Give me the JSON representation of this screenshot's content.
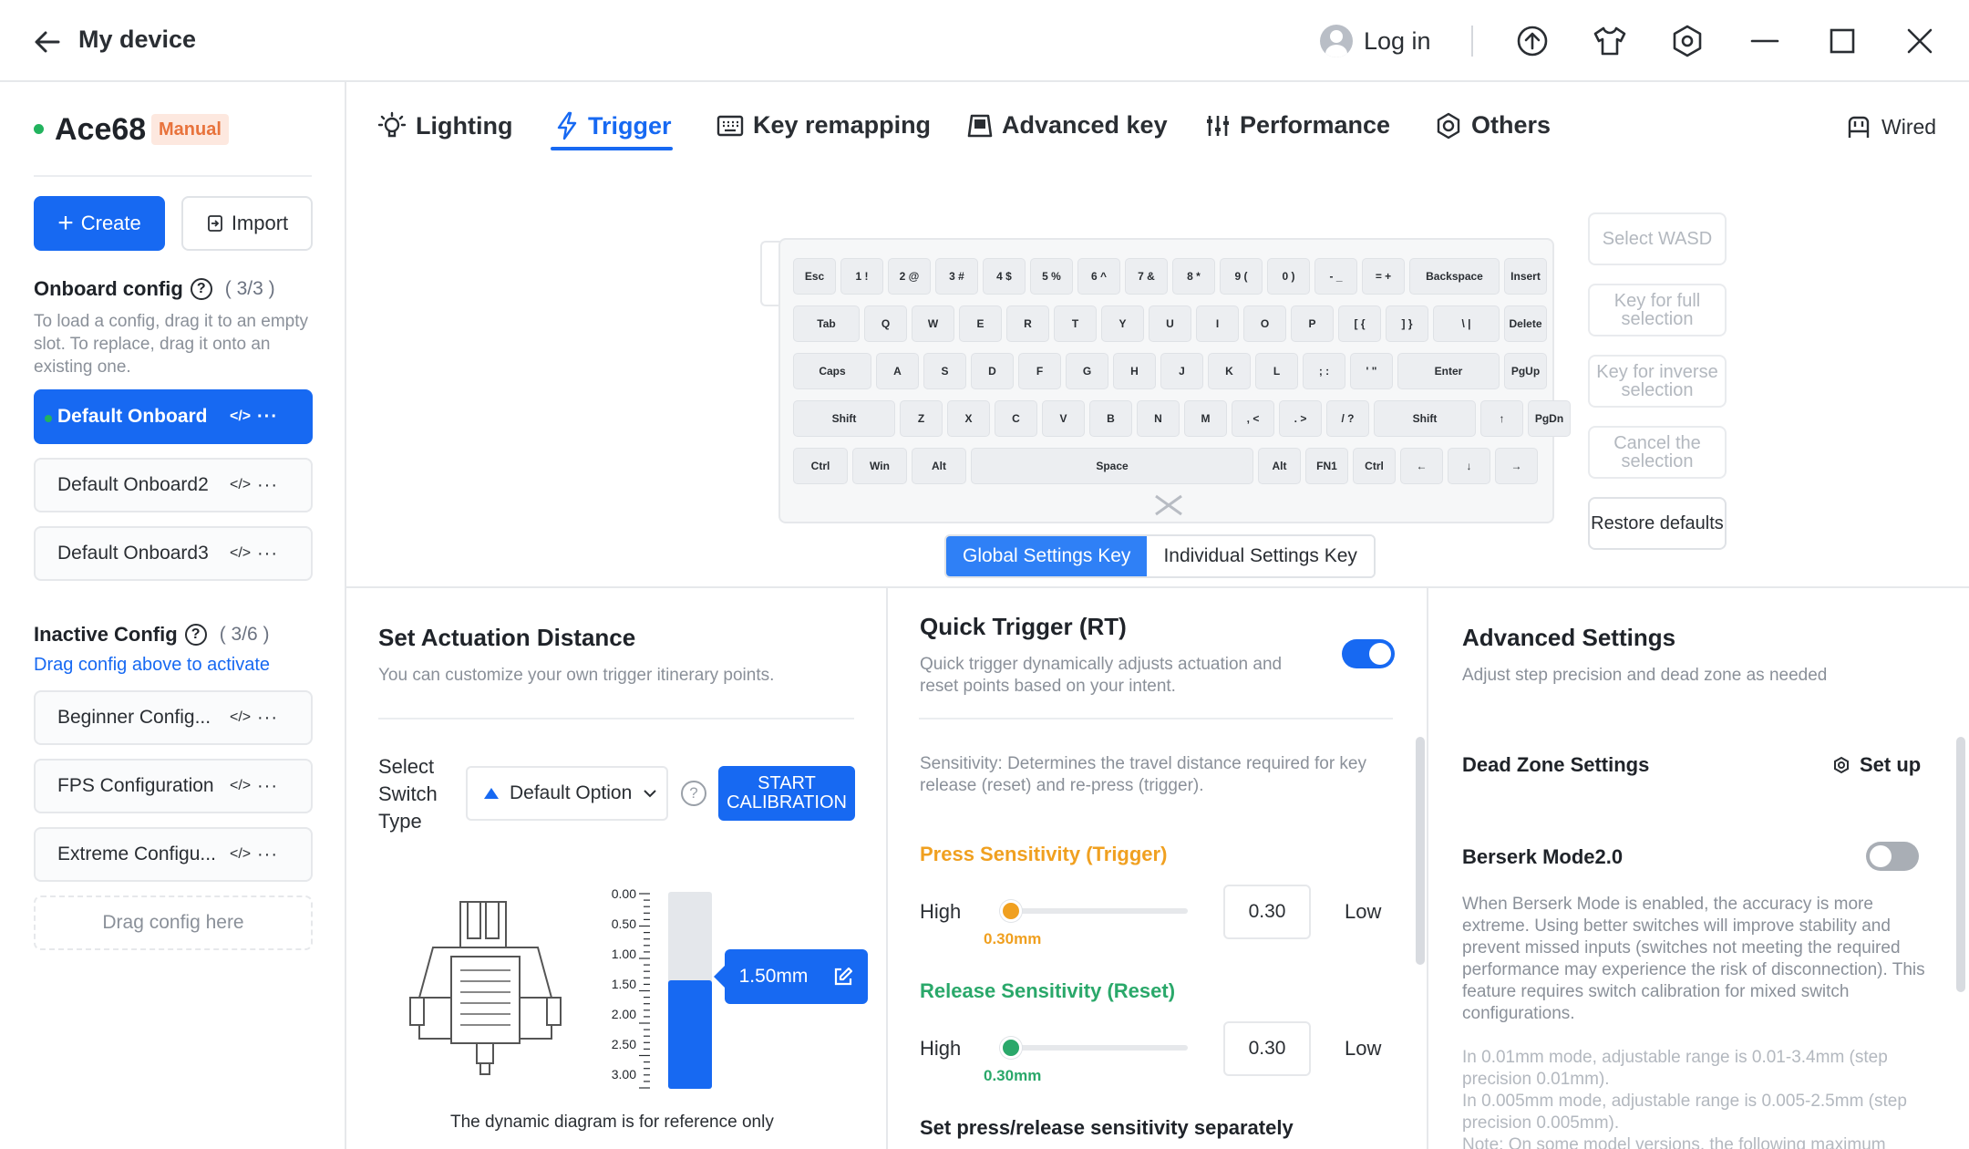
{
  "titlebar": {
    "title": "My device",
    "login": "Log in"
  },
  "device": {
    "name": "Ace68",
    "badge": "Manual"
  },
  "sidebar": {
    "create": "Create",
    "import": "Import",
    "onboard_title": "Onboard config",
    "onboard_count": "( 3/3 )",
    "onboard_desc": "To load a config, drag it to an empty slot. To replace, drag it onto an existing one.",
    "onboard_items": [
      "Default Onboard",
      "Default Onboard2",
      "Default Onboard3"
    ],
    "inactive_title": "Inactive Config",
    "inactive_count": "( 3/6 )",
    "drag_link": "Drag config above to activate",
    "inactive_items": [
      "Beginner Config...",
      "FPS Configuration",
      "Extreme Configu..."
    ],
    "drag_here": "Drag config here",
    "code_icon_text": "</>",
    "more_text": "···"
  },
  "tabs": [
    {
      "label": "Lighting",
      "icon": "bulb-icon"
    },
    {
      "label": "Trigger",
      "icon": "bolt-icon"
    },
    {
      "label": "Key remapping",
      "icon": "keyboard-icon"
    },
    {
      "label": "Advanced key",
      "icon": "advanced-key-icon"
    },
    {
      "label": "Performance",
      "icon": "sliders-icon"
    },
    {
      "label": "Others",
      "icon": "gear-icon"
    }
  ],
  "active_tab": "Trigger",
  "connection": "Wired",
  "keyboard": {
    "rows": [
      [
        "Esc",
        "1 !",
        "2 @",
        "3 #",
        "4 $",
        "5 %",
        "6 ^",
        "7 &",
        "8 *",
        "9 (",
        "0 )",
        "- _",
        "= +",
        "Backspace",
        "Insert"
      ],
      [
        "Tab",
        "Q",
        "W",
        "E",
        "R",
        "T",
        "Y",
        "U",
        "I",
        "O",
        "P",
        "[ {",
        "] }",
        "\\ |",
        "Delete"
      ],
      [
        "Caps",
        "A",
        "S",
        "D",
        "F",
        "G",
        "H",
        "J",
        "K",
        "L",
        "; :",
        "' \"",
        "Enter",
        "PgUp"
      ],
      [
        "Shift",
        "Z",
        "X",
        "C",
        "V",
        "B",
        "N",
        "M",
        ", <",
        ". >",
        "/ ?",
        "Shift",
        "↑",
        "PgDn"
      ],
      [
        "Ctrl",
        "Win",
        "Alt",
        "Space",
        "Alt",
        "FN1",
        "Ctrl",
        "←",
        "↓",
        "→"
      ]
    ]
  },
  "selection_buttons": [
    "Select WASD",
    "Key for full selection",
    "Key for inverse selection",
    "Cancel the selection",
    "Restore defaults"
  ],
  "settings_toggle": {
    "global": "Global Settings Key",
    "individual": "Individual Settings Key"
  },
  "actuation": {
    "title": "Set Actuation Distance",
    "desc": "You can customize your own trigger itinerary points.",
    "switch_label": "Select Switch Type",
    "switch_value": "Default Option",
    "calibrate": "START CALIBRATION",
    "scale": [
      "0.00",
      "0.50",
      "1.00",
      "1.50",
      "2.00",
      "2.50",
      "3.00"
    ],
    "value": "1.50mm",
    "level": 1.5,
    "max": 3.0,
    "note": "The dynamic diagram is for reference only"
  },
  "quick_trigger": {
    "title": "Quick Trigger (RT)",
    "desc": "Quick trigger dynamically adjusts actuation and reset points based on your intent.",
    "enabled": true,
    "sensitivity_desc": "Sensitivity: Determines the travel distance required for key release (reset) and re-press (trigger).",
    "press_title": "Press Sensitivity (Trigger)",
    "press_color": "#f0a020",
    "release_title": "Release Sensitivity (Reset)",
    "release_color": "#2aa86a",
    "high": "High",
    "low": "Low",
    "press_value": "0.30",
    "press_mm": "0.30mm",
    "release_value": "0.30",
    "release_mm": "0.30mm",
    "separate": "Set press/release sensitivity separately"
  },
  "advanced": {
    "title": "Advanced Settings",
    "desc": "Adjust step precision and dead zone as needed",
    "dead_zone": "Dead Zone Settings",
    "setup": "Set up",
    "berserk": "Berserk Mode2.0",
    "berserk_enabled": false,
    "berserk_desc": "When Berserk Mode is enabled, the accuracy is more extreme. Using better switches will improve stability and prevent missed inputs (switches not meeting the required performance may experience the risk of disconnection). This feature requires switch calibration for mixed switch configurations.",
    "range_note": "In 0.01mm mode, adjustable range is 0.01-3.4mm (step precision 0.01mm).\nIn 0.005mm mode, adjustable range is 0.005-2.5mm (step precision 0.005mm).\nNote: On some model versions, the following maximum"
  },
  "colors": {
    "accent": "#1769f2",
    "online": "#22b35e"
  }
}
